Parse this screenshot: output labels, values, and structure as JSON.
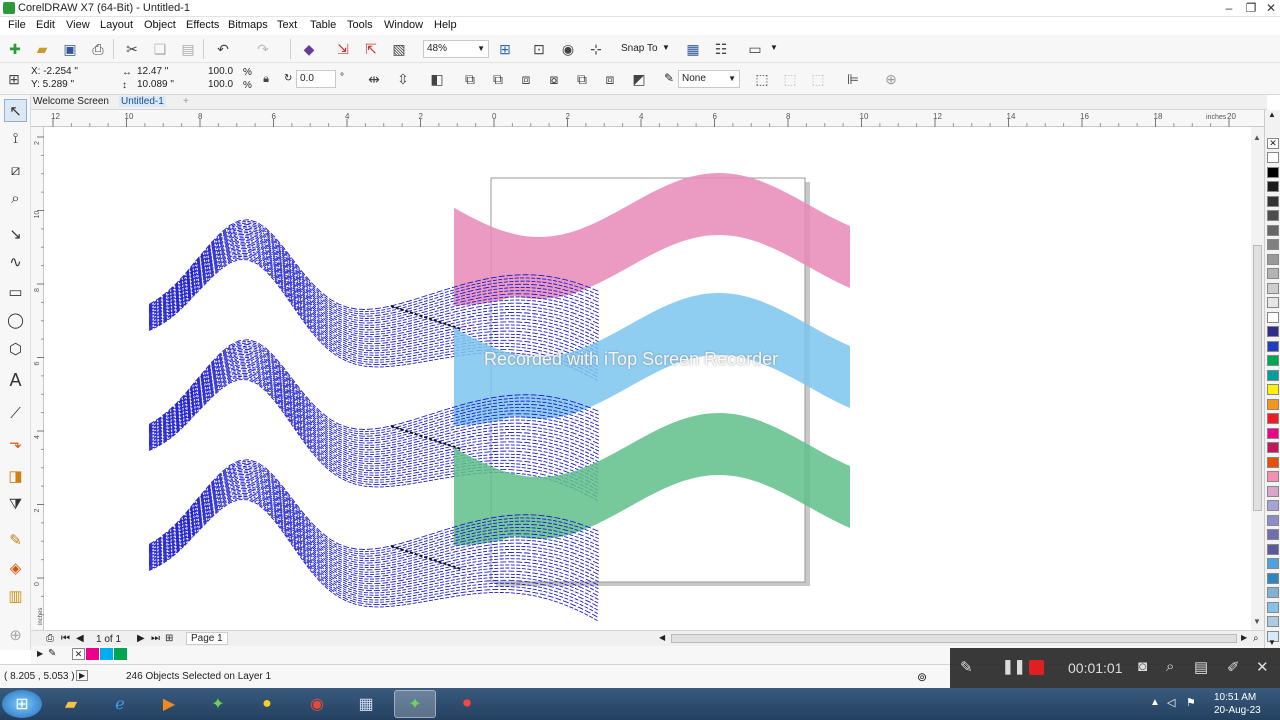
{
  "window": {
    "title": "CorelDRAW X7 (64-Bit) - Untitled-1"
  },
  "menu": [
    "File",
    "Edit",
    "View",
    "Layout",
    "Object",
    "Effects",
    "Bitmaps",
    "Text",
    "Table",
    "Tools",
    "Window",
    "Help"
  ],
  "toolbar": {
    "zoom": "48%",
    "snap_label": "Snap To"
  },
  "property_bar": {
    "x": "X: -2.254 \"",
    "y": "Y: 5.289 \"",
    "width": "12.47 \"",
    "height": "10.089 \"",
    "scale_w": "100.0",
    "scale_h": "100.0",
    "pct": "%",
    "rotation": "0.0",
    "deg": "°",
    "outline": "None"
  },
  "doc_tabs": [
    "Welcome Screen",
    "Untitled-1"
  ],
  "ruler": {
    "h_ticks": [
      "12",
      "10",
      "8",
      "6",
      "4",
      "2",
      "0",
      "2",
      "4",
      "6",
      "8",
      "10",
      "12",
      "14",
      "16",
      "18",
      "20"
    ],
    "unit": "inches",
    "v_ticks": [
      "2",
      "10",
      "8",
      "6",
      "4",
      "2",
      "0"
    ]
  },
  "page_nav": {
    "counter": "1 of 1",
    "page_tab": "Page 1"
  },
  "status": {
    "cursor": "( 8.205 , 5.053 )",
    "selection": "246 Objects Selected on Layer 1"
  },
  "recorder": {
    "time": "00:01:01",
    "watermark": "Recorded with iTop Screen Recorder"
  },
  "taskbar": {
    "time": "10:51 AM",
    "date": "20-Aug-23"
  },
  "colors": {
    "pink": "#e889b7",
    "blue": "#7cc6ee",
    "green": "#5fbf8a",
    "wire": "#1a1acc"
  },
  "palette": [
    "#ffffff",
    "#000000",
    "#1a1a1a",
    "#333333",
    "#4d4d4d",
    "#666666",
    "#808080",
    "#999999",
    "#b3b3b3",
    "#cccccc",
    "#e6e6e6",
    "#ffffff",
    "#2e2e8a",
    "#1f3fbf",
    "#00a651",
    "#009f9f",
    "#fff200",
    "#f7941d",
    "#ed1c24",
    "#ec008c",
    "#c2185b",
    "#e65100",
    "#f48fb1",
    "#d7a6c9",
    "#a4a4d8",
    "#8c8cc8",
    "#6f6fae",
    "#5a5a9a",
    "#4aa3df",
    "#2e86c1",
    "#7fb3d5",
    "#85c1e9",
    "#a9cce3",
    "#d6eaf8"
  ]
}
